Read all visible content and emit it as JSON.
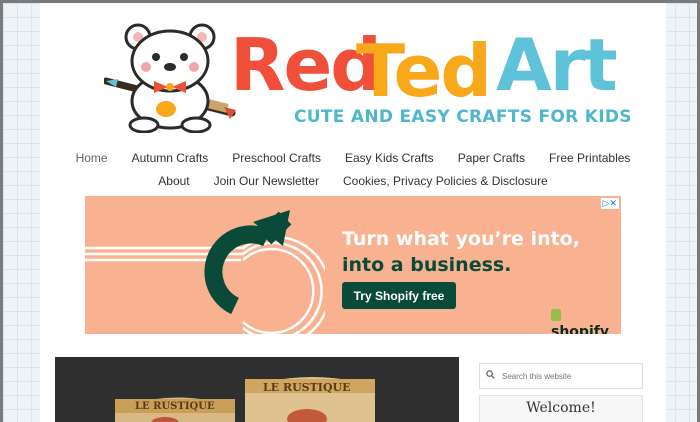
{
  "brand": {
    "word1": "Red",
    "word2": "Ted",
    "word3": "Art",
    "tagline": "CUTE AND EASY CRAFTS FOR KIDS",
    "colors": {
      "red": "#f0503a",
      "orange": "#f7a81b",
      "blue": "#5ec3d8",
      "tagline": "#4fb6cc"
    }
  },
  "nav": {
    "row1": [
      "Home",
      "Autumn Crafts",
      "Preschool Crafts",
      "Easy Kids Crafts",
      "Paper Crafts",
      "Free Printables"
    ],
    "row2": [
      "About",
      "Join Our Newsletter",
      "Cookies, Privacy Policies & Disclosure"
    ]
  },
  "ad": {
    "headline_line1": "Turn what you’re into,",
    "headline_line2": "into a business.",
    "cta": "Try Shopify free",
    "brand": "shopify",
    "choices_icon": "adchoices-icon",
    "background": "#f9b291",
    "accent": "#0a4a39"
  },
  "sidebar": {
    "search_placeholder": "Search this website",
    "welcome_title": "Welcome!"
  },
  "photo": {
    "label1": "LE RUSTIQUE",
    "label2": "LE RUSTIQUE"
  }
}
